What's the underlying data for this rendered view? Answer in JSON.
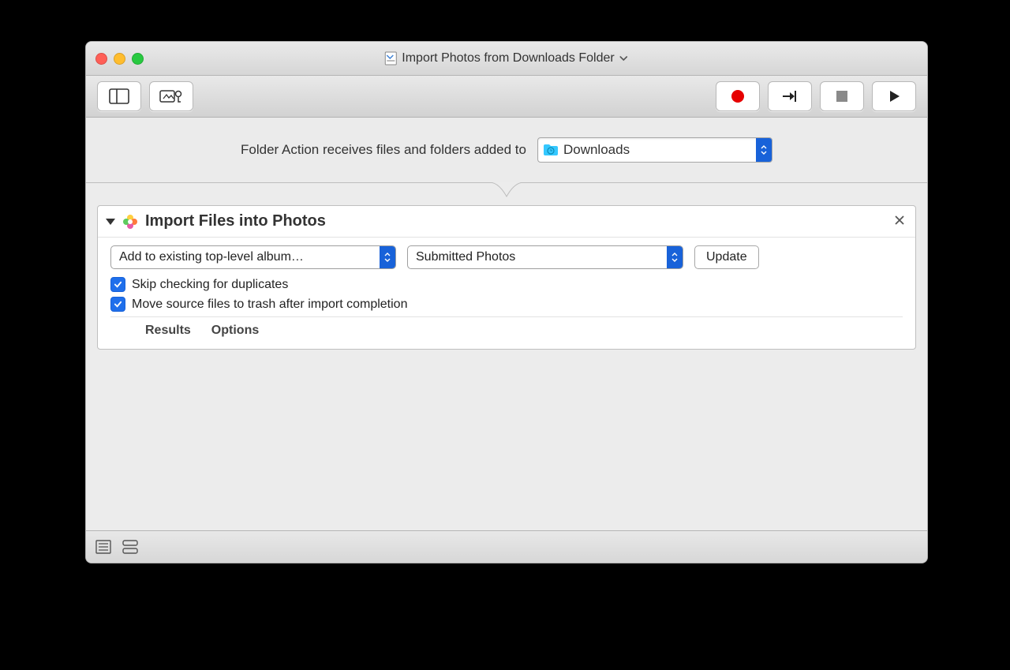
{
  "window": {
    "title": "Import Photos from Downloads Folder"
  },
  "config": {
    "label": "Folder Action receives files and folders added to",
    "folder_name": "Downloads"
  },
  "action": {
    "title": "Import Files into Photos",
    "album_mode": "Add to existing top-level album…",
    "album_target": "Submitted Photos",
    "update_button": "Update",
    "skip_duplicates_label": "Skip checking for duplicates",
    "move_to_trash_label": "Move source files to trash after import completion",
    "skip_duplicates_checked": true,
    "move_to_trash_checked": true
  },
  "footer": {
    "results": "Results",
    "options": "Options"
  }
}
